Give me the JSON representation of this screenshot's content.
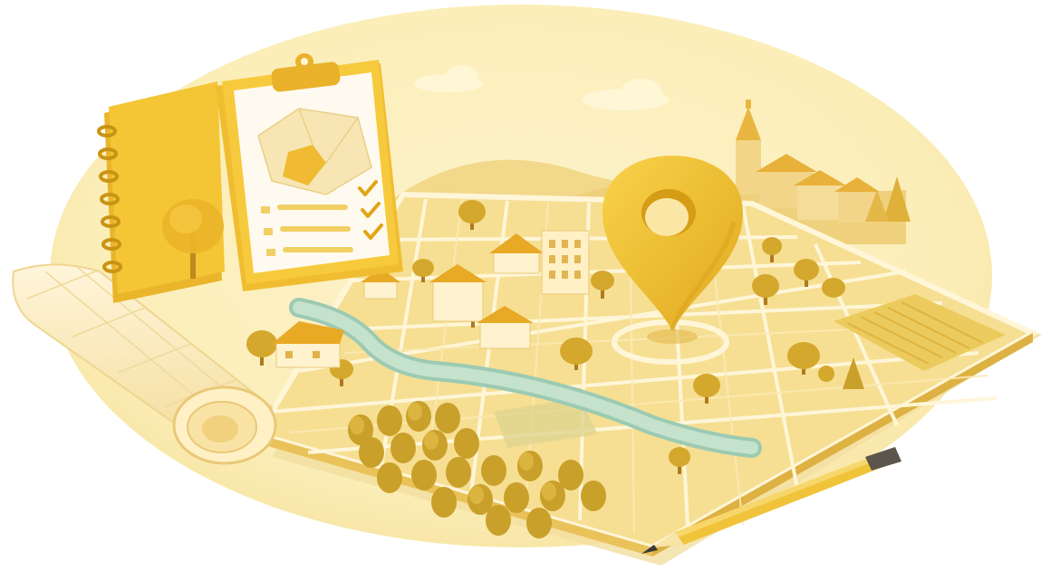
{
  "scene": {
    "subject": "map-planning-illustration",
    "palette": {
      "background": "#ffffff",
      "backdrop": "#fbeeb8",
      "backdrop_edge": "#f7e3a0",
      "hills": "#f2d88a",
      "map_base": "#f6df93",
      "map_block": "#f2d27a",
      "map_block_alt": "#eccb6c",
      "street": "#fff6d8",
      "river": "#bfdcc8",
      "river_edge": "#9ccab2",
      "tree": "#d7ab2c",
      "tree_dark": "#c2961c",
      "trunk": "#b07a1e",
      "building_wall": "#fff3cf",
      "building_roof": "#e8a925",
      "pin": "#f3c233",
      "pin_shadow": "#d9a21a",
      "notebook": "#f4c535",
      "clipboard": "#f6ca3c",
      "paper": "#fffaf0",
      "check": "#e1a514",
      "pencil": "#f0c33a",
      "pencil_tip": "#3b3a36"
    },
    "icons": [
      "location-pin-icon",
      "checkmark-icon"
    ]
  }
}
